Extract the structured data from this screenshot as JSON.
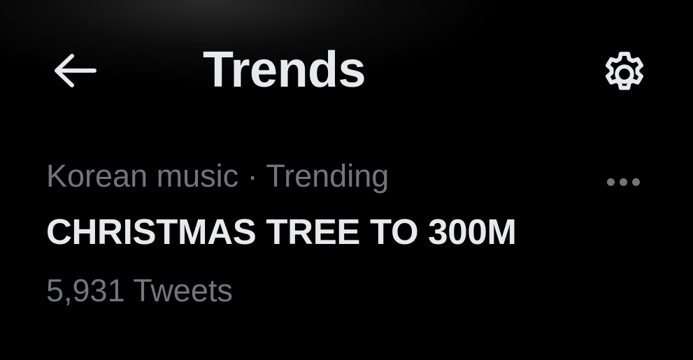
{
  "header": {
    "title": "Trends",
    "back_icon": "arrow-left-icon",
    "settings_icon": "gear-icon"
  },
  "trend": {
    "category": "Korean music",
    "separator": " · ",
    "status": "Trending",
    "name": "CHRISTMAS TREE TO 300M",
    "count": "5,931 Tweets",
    "more_icon": "more-horizontal-icon"
  },
  "colors": {
    "background": "#000000",
    "primary_text": "#e7e9ea",
    "secondary_text": "#71767b"
  }
}
